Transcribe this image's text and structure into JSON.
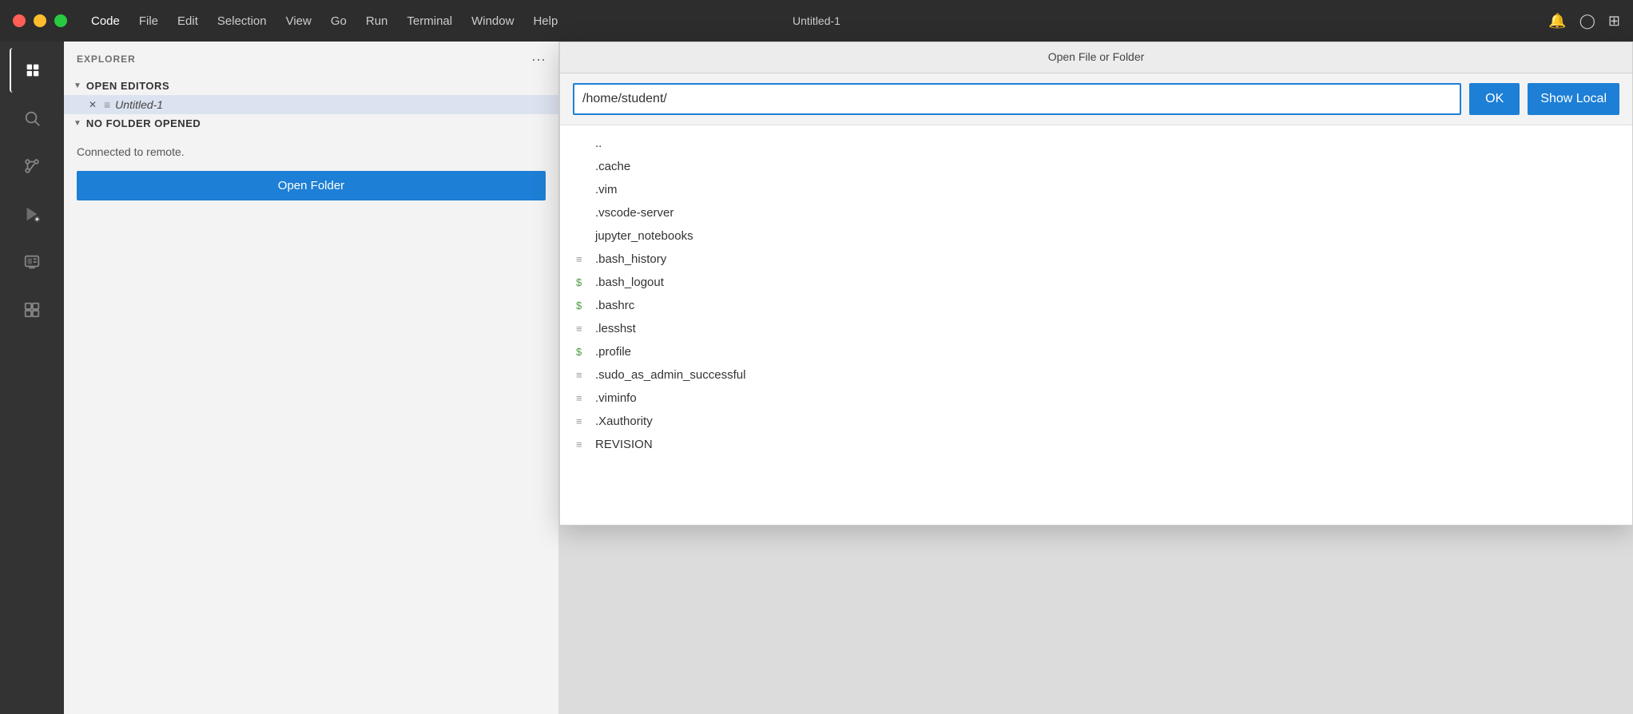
{
  "titlebar": {
    "window_title": "Untitled-1",
    "menu_items": [
      "Code",
      "File",
      "Edit",
      "Selection",
      "View",
      "Go",
      "Run",
      "Terminal",
      "Window",
      "Help"
    ]
  },
  "sidebar": {
    "title": "EXPLORER",
    "open_editors_label": "OPEN EDITORS",
    "no_folder_label": "NO FOLDER OPENED",
    "connected_text": "Connected to remote.",
    "open_folder_btn": "Open Folder",
    "untitled_file": "Untitled-1"
  },
  "dialog": {
    "title": "Open File or Folder",
    "path_value": "/home/student/",
    "ok_label": "OK",
    "show_local_label": "Show Local",
    "files": [
      {
        "name": "..",
        "type": "folder",
        "icon": "none"
      },
      {
        "name": ".cache",
        "type": "folder",
        "icon": "none"
      },
      {
        "name": ".vim",
        "type": "folder",
        "icon": "none"
      },
      {
        "name": ".vscode-server",
        "type": "folder",
        "icon": "none"
      },
      {
        "name": "jupyter_notebooks",
        "type": "folder",
        "icon": "none"
      },
      {
        "name": ".bash_history",
        "type": "file",
        "icon": "lines"
      },
      {
        "name": ".bash_logout",
        "type": "file",
        "icon": "dollar-green"
      },
      {
        "name": ".bashrc",
        "type": "file",
        "icon": "dollar-green"
      },
      {
        "name": ".lesshst",
        "type": "file",
        "icon": "lines"
      },
      {
        "name": ".profile",
        "type": "file",
        "icon": "dollar-green"
      },
      {
        "name": ".sudo_as_admin_successful",
        "type": "file",
        "icon": "lines"
      },
      {
        "name": ".viminfo",
        "type": "file",
        "icon": "lines"
      },
      {
        "name": ".Xauthority",
        "type": "file",
        "icon": "lines"
      },
      {
        "name": "REVISION",
        "type": "file",
        "icon": "lines"
      }
    ]
  }
}
